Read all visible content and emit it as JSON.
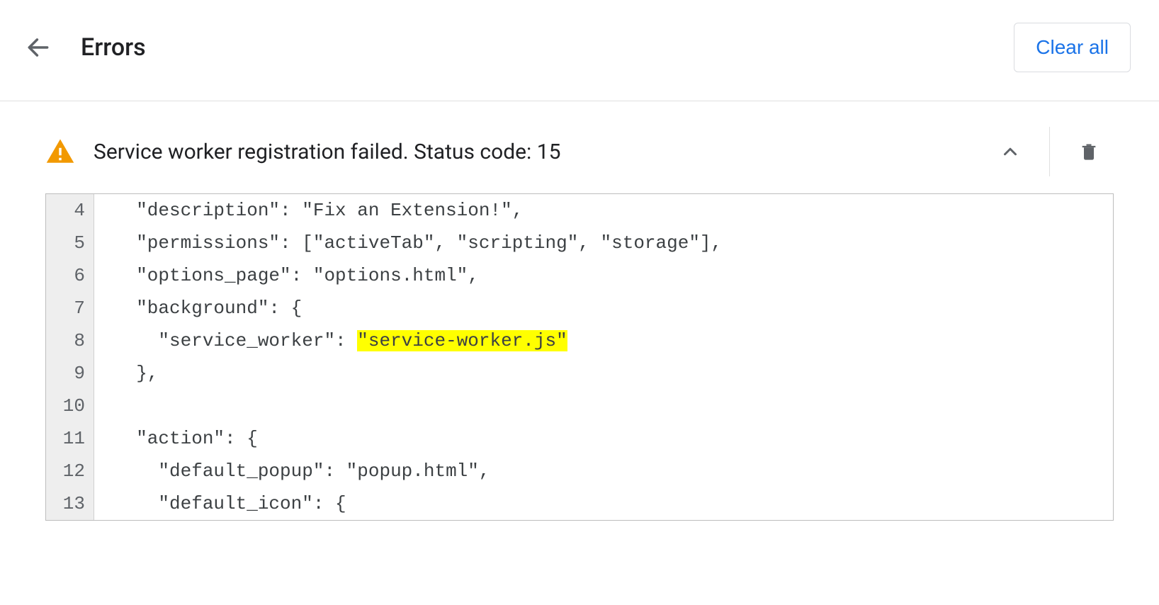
{
  "header": {
    "title": "Errors",
    "clear_all_label": "Clear all"
  },
  "error": {
    "message": "Service worker registration failed. Status code: 15"
  },
  "code": {
    "lines": [
      {
        "num": "4",
        "pre": "  \"description\": \"Fix an Extension!\","
      },
      {
        "num": "5",
        "pre": "  \"permissions\": [\"activeTab\", \"scripting\", \"storage\"],"
      },
      {
        "num": "6",
        "pre": "  \"options_page\": \"options.html\","
      },
      {
        "num": "7",
        "pre": "  \"background\": {"
      },
      {
        "num": "8",
        "pre": "    \"service_worker\": ",
        "hl": "\"service-worker.js\""
      },
      {
        "num": "9",
        "pre": "  },"
      },
      {
        "num": "10",
        "pre": ""
      },
      {
        "num": "11",
        "pre": "  \"action\": {"
      },
      {
        "num": "12",
        "pre": "    \"default_popup\": \"popup.html\","
      },
      {
        "num": "13",
        "pre": "    \"default_icon\": {"
      }
    ]
  }
}
